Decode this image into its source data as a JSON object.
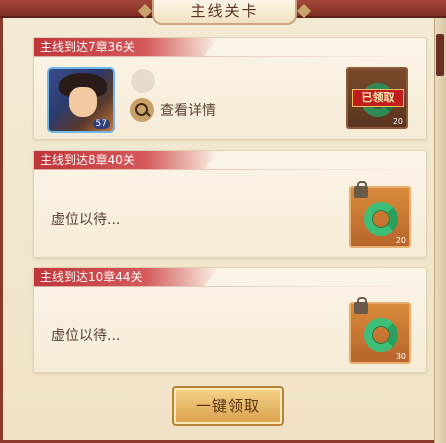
{
  "header": {
    "title": "主线关卡"
  },
  "rewards": [
    {
      "condition": "主线到达7章36关",
      "hero": {
        "level": "57"
      },
      "detail_link": "查看详情",
      "item": {
        "name": "jade-ring-icon",
        "quantity": "20",
        "status": "已领取"
      }
    },
    {
      "condition": "主线到达8章40关",
      "placeholder": "虚位以待...",
      "item": {
        "name": "jade-ring-icon",
        "quantity": "20",
        "locked": true
      }
    },
    {
      "condition": "主线到达10章44关",
      "placeholder": "虚位以待...",
      "item": {
        "name": "jade-ring-icon",
        "quantity": "30",
        "locked": true
      }
    }
  ],
  "footer": {
    "claim_all_label": "一键领取"
  },
  "colors": {
    "accent": "#c0363a",
    "button": "#e8b86a",
    "frame": "#8b3a2a"
  }
}
